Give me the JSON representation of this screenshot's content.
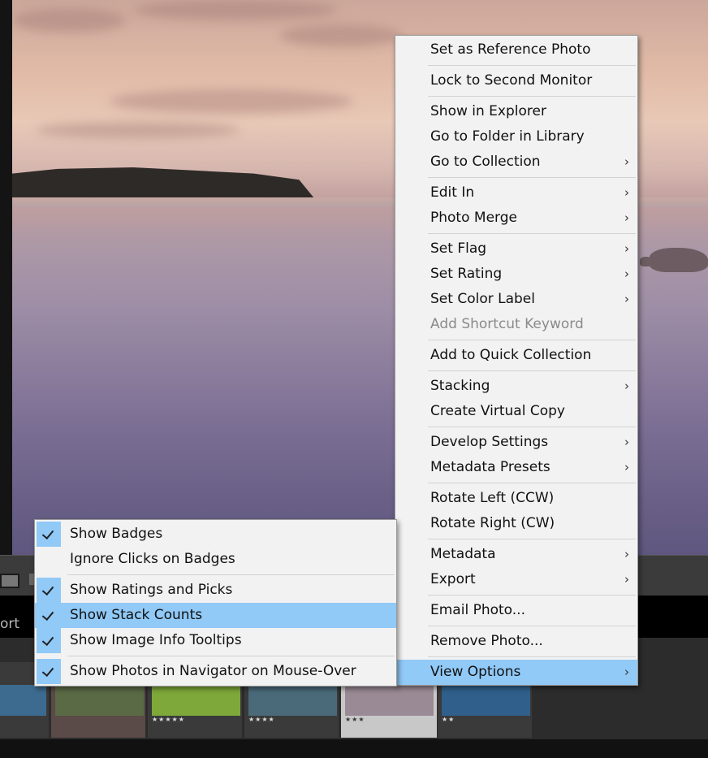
{
  "main_menu": {
    "items": [
      {
        "label": "Set as Reference Photo"
      },
      {
        "sep": true
      },
      {
        "label": "Lock to Second Monitor"
      },
      {
        "sep": true
      },
      {
        "label": "Show in Explorer"
      },
      {
        "label": "Go to Folder in Library"
      },
      {
        "label": "Go to Collection",
        "submenu": true
      },
      {
        "sep": true
      },
      {
        "label": "Edit In",
        "submenu": true
      },
      {
        "label": "Photo Merge",
        "submenu": true
      },
      {
        "sep": true
      },
      {
        "label": "Set Flag",
        "submenu": true
      },
      {
        "label": "Set Rating",
        "submenu": true
      },
      {
        "label": "Set Color Label",
        "submenu": true
      },
      {
        "label": "Add Shortcut Keyword",
        "disabled": true
      },
      {
        "sep": true
      },
      {
        "label": "Add to Quick Collection"
      },
      {
        "sep": true
      },
      {
        "label": "Stacking",
        "submenu": true
      },
      {
        "label": "Create Virtual Copy"
      },
      {
        "sep": true
      },
      {
        "label": "Develop Settings",
        "submenu": true
      },
      {
        "label": "Metadata Presets",
        "submenu": true
      },
      {
        "sep": true
      },
      {
        "label": "Rotate Left (CCW)"
      },
      {
        "label": "Rotate Right (CW)"
      },
      {
        "sep": true
      },
      {
        "label": "Metadata",
        "submenu": true
      },
      {
        "label": "Export",
        "submenu": true
      },
      {
        "sep": true
      },
      {
        "label": "Email Photo..."
      },
      {
        "sep": true
      },
      {
        "label": "Remove Photo..."
      },
      {
        "sep": true
      },
      {
        "label": "View Options",
        "submenu": true,
        "highlighted": true
      }
    ]
  },
  "view_options_menu": {
    "items": [
      {
        "label": "Show Badges",
        "checked": true
      },
      {
        "label": "Ignore Clicks on Badges",
        "checked": false
      },
      {
        "sep": true
      },
      {
        "label": "Show Ratings and Picks",
        "checked": true
      },
      {
        "label": "Show Stack Counts",
        "checked": true,
        "highlighted": true
      },
      {
        "label": "Show Image Info Tooltips",
        "checked": true
      },
      {
        "sep": true
      },
      {
        "label": "Show Photos in Navigator on Mouse-Over",
        "checked": true
      }
    ]
  },
  "toolbar": {
    "sort_label": "ort"
  },
  "filmstrip": {
    "thumbnails": [
      {
        "name": "thumb-mountain-lake",
        "stars": "",
        "color": "#3d6b8f"
      },
      {
        "name": "thumb-forest",
        "stars": "",
        "color": "#5a6a45"
      },
      {
        "name": "thumb-green-hills",
        "stars": "★★★★★",
        "color": "#7fa83a"
      },
      {
        "name": "thumb-city-valley",
        "stars": "★★★★",
        "color": "#4a6a7a"
      },
      {
        "name": "thumb-sunset-beach",
        "stars": "★★★",
        "color": "#9a8a95"
      },
      {
        "name": "thumb-ocean-waves",
        "stars": "★★",
        "color": "#2f5f8a"
      }
    ]
  },
  "colors": {
    "highlight": "#91c9f7",
    "menu_bg": "#f2f2f2"
  }
}
